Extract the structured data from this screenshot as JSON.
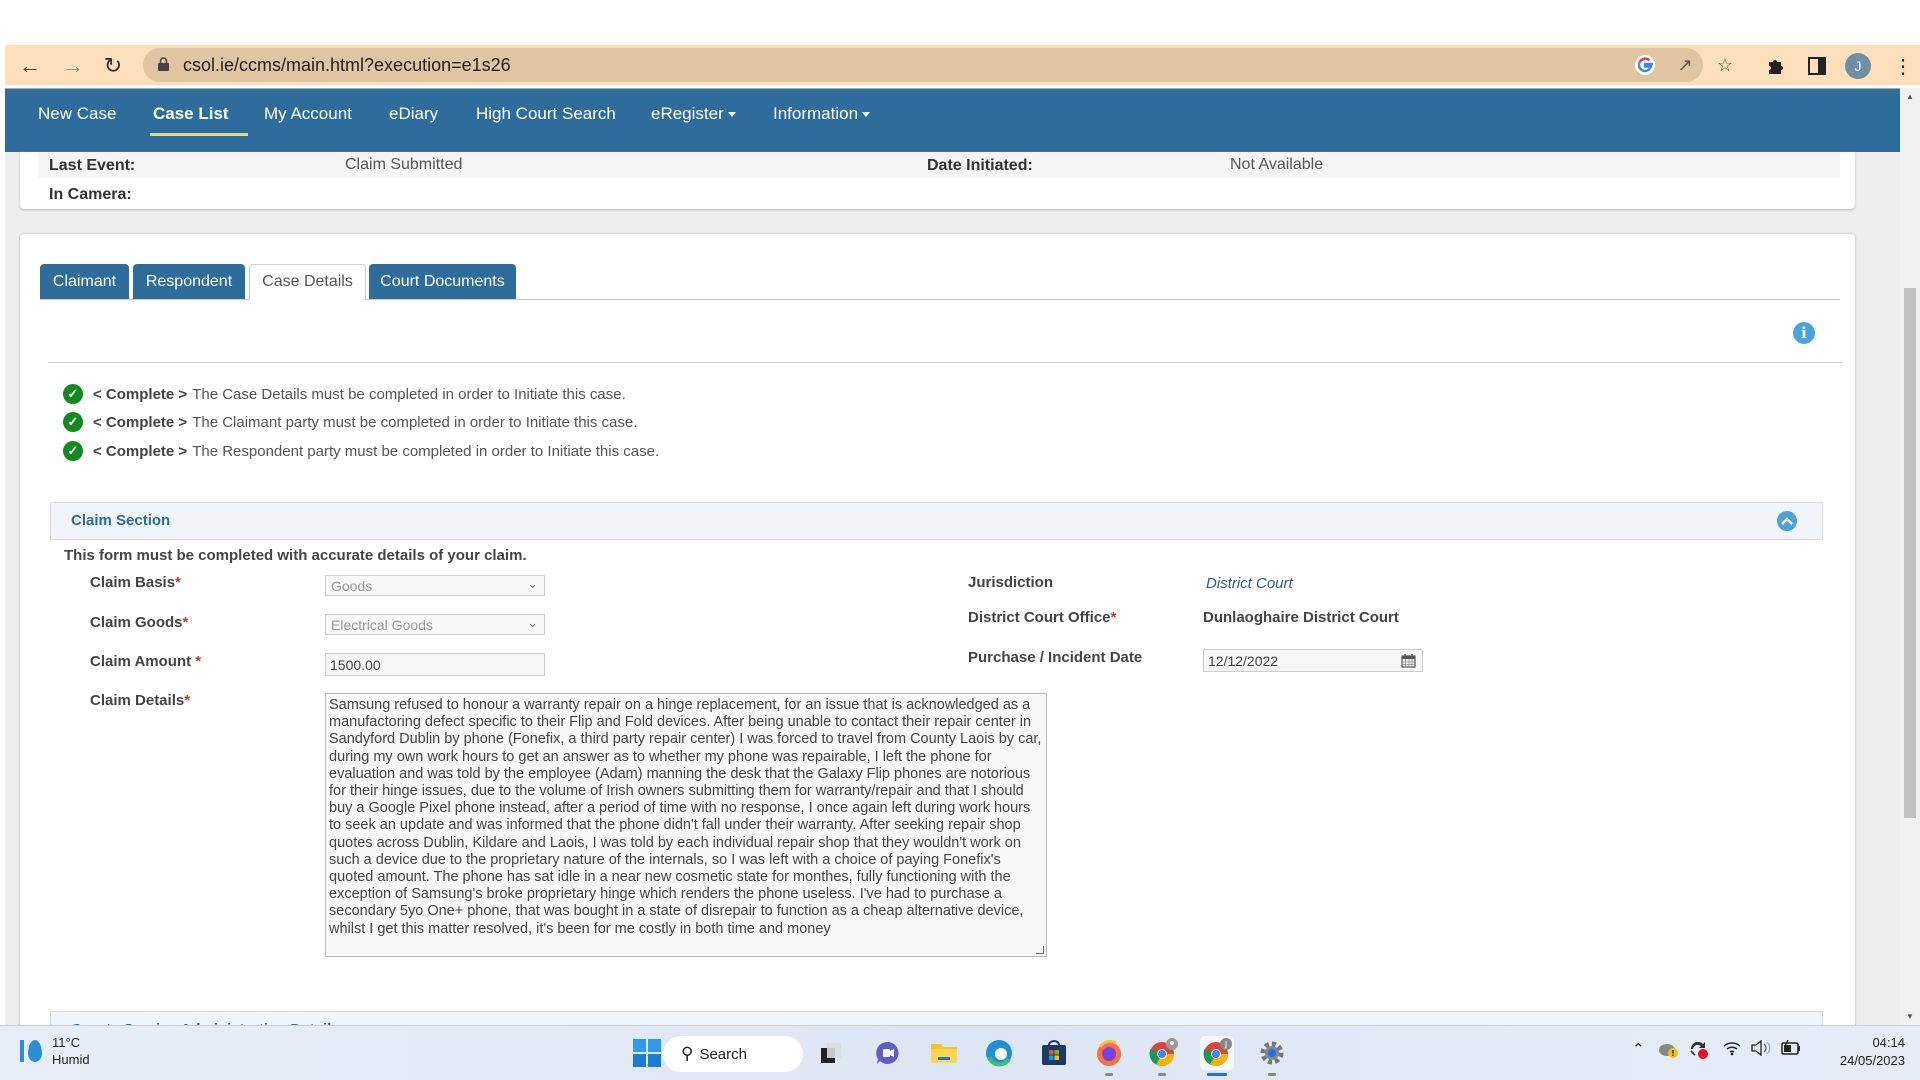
{
  "browser": {
    "url": "csol.ie/ccms/main.html?execution=e1s26",
    "profile_initial": "J",
    "icons": [
      "back-icon",
      "forward-icon",
      "reload-icon",
      "lock-icon",
      "google-icon",
      "share-icon",
      "bookmark-star-icon",
      "extensions-icon",
      "side-panel-icon",
      "profile-avatar",
      "menu-icon"
    ]
  },
  "nav": {
    "items": [
      {
        "label": "New Case"
      },
      {
        "label": "Case List",
        "active": true
      },
      {
        "label": "My Account"
      },
      {
        "label": "eDiary"
      },
      {
        "label": "High Court Search"
      },
      {
        "label": "eRegister",
        "dropdown": true
      },
      {
        "label": "Information",
        "dropdown": true
      }
    ]
  },
  "case_info": {
    "last_event_label": "Last Event:",
    "last_event_value": "Claim Submitted",
    "date_initiated_label": "Date Initiated:",
    "date_initiated_value": "Not Available",
    "in_camera_label": "In Camera:"
  },
  "tabs": [
    {
      "label": "Claimant"
    },
    {
      "label": "Respondent"
    },
    {
      "label": "Case Details",
      "active": true
    },
    {
      "label": "Court Documents"
    }
  ],
  "checklist": [
    {
      "status": "< Complete >",
      "text": "The Case Details must be completed in order to Initiate this case."
    },
    {
      "status": "< Complete >",
      "text": "The Claimant party must be completed in order to Initiate this case."
    },
    {
      "status": "< Complete >",
      "text": "The Respondent party must be completed in order to Initiate this case."
    }
  ],
  "claim_section": {
    "title": "Claim Section",
    "note": "This form must be completed with accurate details of your claim.",
    "claim_basis": {
      "label": "Claim Basis",
      "value": "Goods"
    },
    "claim_goods": {
      "label": "Claim Goods",
      "value": "Electrical Goods"
    },
    "claim_amount": {
      "label": "Claim Amount ",
      "value": "1500.00"
    },
    "claim_details": {
      "label": "Claim Details",
      "value": "Samsung refused to honour a warranty repair on a hinge replacement, for an issue that is acknowledged as a manufactoring defect specific to their Flip and Fold devices. After being unable to contact their repair center in Sandyford Dublin by phone (Fonefix, a third party repair center) I was forced to travel from County Laois by car, during my own work hours to get an answer as to whether my phone was repairable, I left the phone for evaluation and was told by the employee (Adam) manning the desk that the Galaxy Flip phones are notorious for their hinge issues, due to the volume of Irish owners submitting them for warranty/repair and that I should buy a Google Pixel phone instead, after a period of time with no response, I once again left during work hours to seek an update and was informed that the phone didn't fall under their warranty. After seeking repair shop quotes across Dublin, Kildare and Laois, I was told by each individual repair shop that they wouldn't work on such a device due to the proprietary nature of the internals, so I was left with a choice of paying Fonefix's quoted amount. The phone has sat idle in a near new cosmetic state for monthes, fully functioning with the exception of Samsung's broke proprietary hinge which renders the phone useless. I've had to purchase a secondary 5yo One+ phone, that was bought in a state of disrepair to function as a cheap alternative device, whilst I get this matter resolved, it's been for me costly in both time and money"
    },
    "jurisdiction": {
      "label": "Jurisdiction",
      "value": "District Court"
    },
    "district_office": {
      "label": "District Court Office",
      "value": "Dunlaoghaire District Court"
    },
    "incident_date": {
      "label": "Purchase / Incident Date",
      "value": "12/12/2022"
    },
    "required_marker": "*"
  },
  "next_section": {
    "title": "Courts Service Administration Details"
  },
  "taskbar": {
    "weather_temp": "11°C",
    "weather_desc": "Humid",
    "search_label": "Search",
    "time": "04:14",
    "date": "24/05/2023"
  },
  "colors": {
    "nav_blue": "#2e6c9b",
    "toolbar_tan": "#fde0bb",
    "check_green": "#138a1f",
    "info_blue": "#4aa3df",
    "required_red": "#c0392b",
    "active_underline": "#e7d884"
  }
}
